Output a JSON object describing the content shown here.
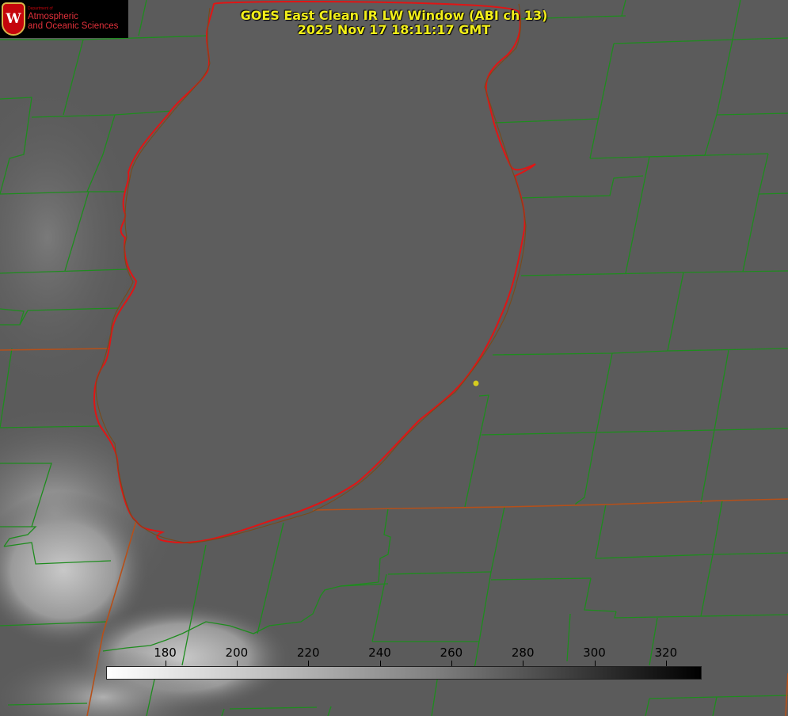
{
  "header": {
    "title_line1": "GOES East Clean IR LW Window (ABI ch 13)",
    "title_line2": "2025 Nov 17 18:11:17 GMT"
  },
  "logo": {
    "crest_letter": "W",
    "dept_text": "Department of",
    "line1": "Atmospheric",
    "line2": "and Oceanic Sciences",
    "accent_color": "#c5050c"
  },
  "colorbar": {
    "ticks": [
      "180",
      "200",
      "220",
      "240",
      "260",
      "280",
      "300",
      "320"
    ],
    "min_value": 163.5,
    "max_value": 330
  },
  "map": {
    "region": "Lake Michigan",
    "county_line_color": "#1e8c1e",
    "shoreline_color": "#e01515",
    "state_line_color": "#b5501a",
    "marker_color": "#d6cc1e"
  }
}
